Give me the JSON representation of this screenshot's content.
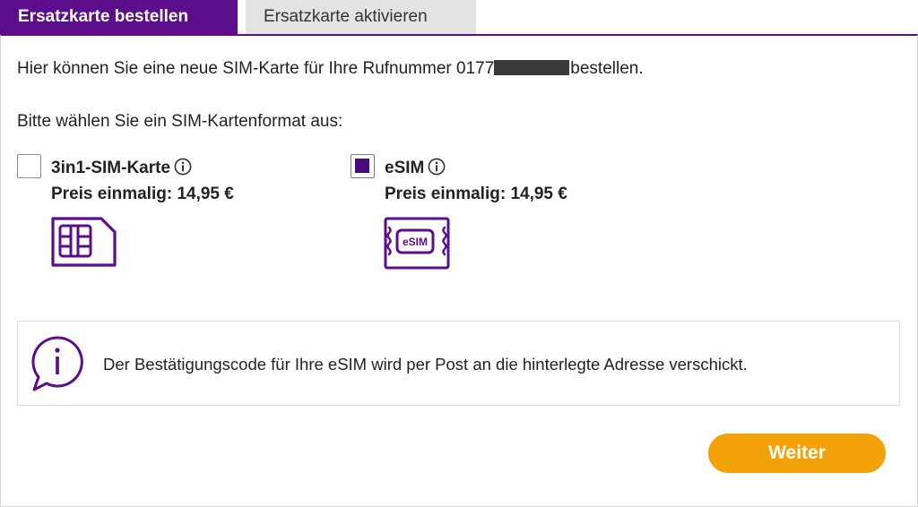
{
  "tabs": [
    {
      "label": "Ersatzkarte bestellen",
      "active": true
    },
    {
      "label": "Ersatzkarte aktivieren",
      "active": false
    }
  ],
  "intro": {
    "before": "Hier können Sie eine neue SIM-Karte für Ihre Rufnummer 0177",
    "after": "bestellen."
  },
  "choose_label": "Bitte wählen Sie ein SIM-Kartenformat aus:",
  "options": [
    {
      "title": "3in1-SIM-Karte",
      "price": "Preis einmalig: 14,95 €",
      "checked": false,
      "icon": "sim-card-icon"
    },
    {
      "title": "eSIM",
      "price": "Preis einmalig: 14,95 €",
      "checked": true,
      "icon": "esim-chip-icon",
      "chip_label": "eSIM"
    }
  ],
  "notice": {
    "icon": "info-speech-bubble-icon",
    "text": "Der Bestätigungscode für Ihre eSIM wird per Post an die hinterlegte Adresse verschickt."
  },
  "next_button": {
    "label": "Weiter"
  },
  "colors": {
    "brand_purple": "#5b0d8c",
    "accent_orange": "#f3a20a",
    "tab_inactive_bg": "#e3e3e3"
  }
}
